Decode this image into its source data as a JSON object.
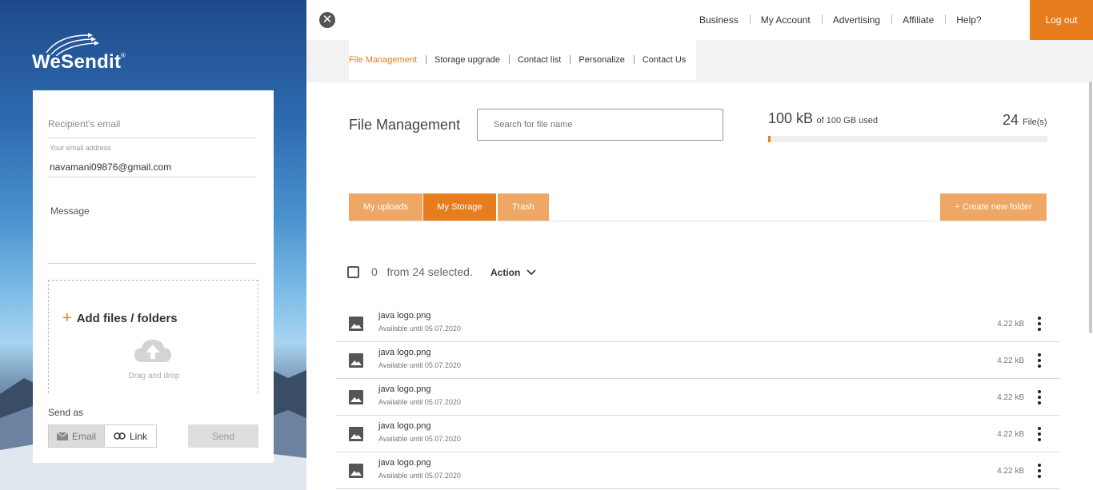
{
  "brand": {
    "name": "WeSendit",
    "reg": "®"
  },
  "send_form": {
    "recipient_placeholder": "Recipient's email",
    "your_email_label": "Your email address",
    "your_email_value": "navamani09876@gmail.com",
    "message_placeholder": "Message",
    "add_files_label": "Add files / folders",
    "drag_drop_label": "Drag and drop",
    "send_as_label": "Send as",
    "email_button": "Email",
    "link_button": "Link",
    "send_button": "Send"
  },
  "top_nav": {
    "items": [
      "Business",
      "My Account",
      "Advertising",
      "Affiliate",
      "Help?"
    ],
    "logout": "Log out"
  },
  "sub_nav": {
    "items": [
      "File Management",
      "Storage upgrade",
      "Contact list",
      "Personalize",
      "Contact Us"
    ],
    "active_index": 0
  },
  "main": {
    "title": "File Management",
    "search_placeholder": "Search for file name",
    "used_amount": "100 kB",
    "used_of": "of 100 GB used",
    "usage_fraction": 0.01,
    "files_count": "24",
    "files_label": "File(s)",
    "tabs": [
      "My uploads",
      "My Storage",
      "Trash"
    ],
    "active_tab": 1,
    "create_folder": "+ Create new folder",
    "selection_text": "0   from 24 selected.",
    "action_label": "Action"
  },
  "files": [
    {
      "name": "java logo.png",
      "availability": "Available until 05.07.2020",
      "size": "4.22 kB"
    },
    {
      "name": "java logo.png",
      "availability": "Available until 05.07.2020",
      "size": "4.22 kB"
    },
    {
      "name": "java logo.png",
      "availability": "Available until 05.07.2020",
      "size": "4.22 kB"
    },
    {
      "name": "java logo.png",
      "availability": "Available until 05.07.2020",
      "size": "4.22 kB"
    },
    {
      "name": "java logo.png",
      "availability": "Available until 05.07.2020",
      "size": "4.22 kB"
    }
  ],
  "colors": {
    "accent": "#e87d1e",
    "accent_light": "#eea765"
  },
  "icons": [
    "close-icon",
    "plus-icon",
    "cloud-upload-icon",
    "mail-icon",
    "link-icon",
    "checkbox-icon",
    "chevron-down-icon",
    "image-icon",
    "more-vert-icon"
  ]
}
